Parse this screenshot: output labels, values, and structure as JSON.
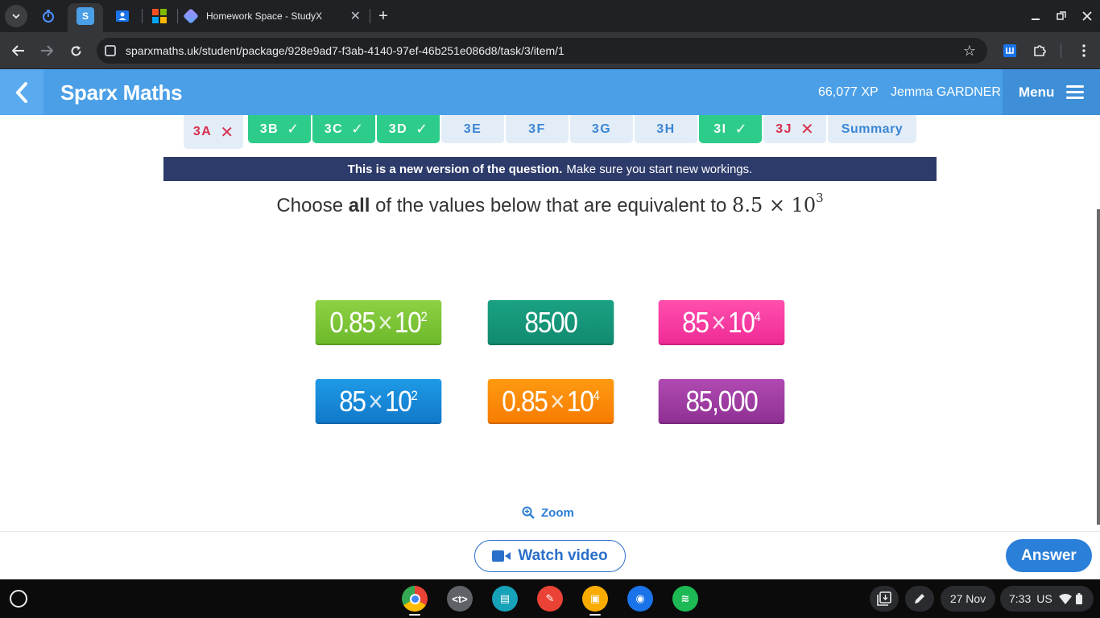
{
  "browser": {
    "tab_title": "Homework Space - StudyX",
    "url": "sparxmaths.uk/student/package/928e9ad7-f3ab-4140-97ef-46b251e086d8/task/3/item/1",
    "pinned_tabs": [
      {
        "name": "focus-timer",
        "glyph": "⏱",
        "color": "#4d90fe"
      },
      {
        "name": "sparx",
        "glyph": "S",
        "color": "#4a9fe7"
      },
      {
        "name": "classroom",
        "glyph": "👤",
        "color": "#1a73e8"
      },
      {
        "name": "microsoft",
        "glyph": "",
        "color": "#f25022"
      }
    ]
  },
  "header": {
    "brand": "Sparx Maths",
    "xp": "66,077 XP",
    "username": "Jemma GARDNER",
    "menu_label": "Menu"
  },
  "task_tabs": [
    {
      "label": "3A",
      "status": "wrong",
      "mark": "✕"
    },
    {
      "label": "3B",
      "status": "done",
      "mark": "✓"
    },
    {
      "label": "3C",
      "status": "done",
      "mark": "✓"
    },
    {
      "label": "3D",
      "status": "done",
      "mark": "✓"
    },
    {
      "label": "3E",
      "status": "todo",
      "mark": ""
    },
    {
      "label": "3F",
      "status": "todo",
      "mark": ""
    },
    {
      "label": "3G",
      "status": "todo",
      "mark": ""
    },
    {
      "label": "3H",
      "status": "todo",
      "mark": ""
    },
    {
      "label": "3I",
      "status": "done",
      "mark": "✓"
    },
    {
      "label": "3J",
      "status": "wrong",
      "mark": "✕"
    },
    {
      "label": "Summary",
      "status": "todo",
      "mark": ""
    }
  ],
  "banner": {
    "bold": "This is a new version of the question.",
    "rest": "Make sure you start new workings."
  },
  "question": {
    "prefix": "Choose",
    "emphasis": "all",
    "suffix": "of the values below that are equivalent to",
    "math_base": "8.5 × 10",
    "math_exp": "3"
  },
  "options": [
    {
      "mantissa": "0.85",
      "exponent": "2",
      "plain": "",
      "color": "green"
    },
    {
      "mantissa": "",
      "exponent": "",
      "plain": "8500",
      "color": "teal"
    },
    {
      "mantissa": "85",
      "exponent": "4",
      "plain": "",
      "color": "pink"
    },
    {
      "mantissa": "85",
      "exponent": "2",
      "plain": "",
      "color": "blue"
    },
    {
      "mantissa": "0.85",
      "exponent": "4",
      "plain": "",
      "color": "orange"
    },
    {
      "mantissa": "",
      "exponent": "",
      "plain": "85,000",
      "color": "purple"
    }
  ],
  "times_symbol": "×",
  "ten": "10",
  "footer": {
    "zoom_label": "Zoom",
    "watch_label": "Watch video",
    "answer_label": "Answer"
  },
  "shelf": {
    "date": "27 Nov",
    "time": "7:33",
    "locale": "US",
    "apps": [
      {
        "name": "chrome",
        "color": "#e8453c",
        "glyph": ""
      },
      {
        "name": "terminal",
        "color": "#5f6368",
        "glyph": "<t>"
      },
      {
        "name": "news",
        "color": "#16a2b8",
        "glyph": "▤"
      },
      {
        "name": "canvas",
        "color": "#ea4335",
        "glyph": "✎"
      },
      {
        "name": "classroom",
        "color": "#f9ab00",
        "glyph": "▣"
      },
      {
        "name": "camera",
        "color": "#1a73e8",
        "glyph": "◉"
      },
      {
        "name": "spotify",
        "color": "#1db954",
        "glyph": "≋"
      }
    ]
  }
}
